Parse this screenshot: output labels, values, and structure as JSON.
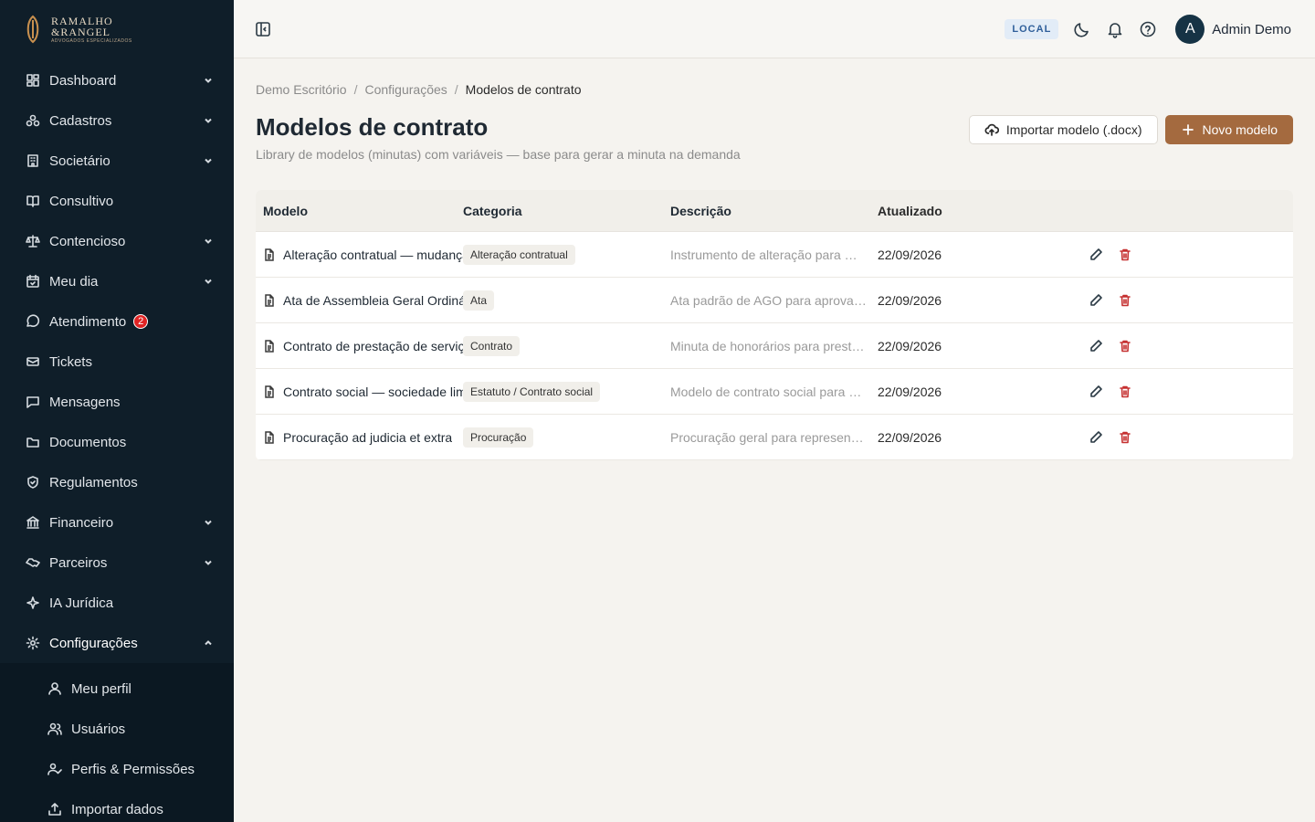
{
  "brand": {
    "line1": "RAMALHO",
    "line2": "&RANGEL",
    "tagline": "ADVOGADOS ESPECIALIZADOS",
    "accent": "#a46a3f",
    "sidebar_bg": "#0f1e29"
  },
  "sidebar": {
    "items": [
      {
        "label": "Dashboard",
        "icon": "dashboard-icon",
        "expandable": true
      },
      {
        "label": "Cadastros",
        "icon": "cadastros-icon",
        "expandable": true
      },
      {
        "label": "Societário",
        "icon": "building-icon",
        "expandable": true
      },
      {
        "label": "Consultivo",
        "icon": "book-icon",
        "expandable": false
      },
      {
        "label": "Contencioso",
        "icon": "scale-icon",
        "expandable": true
      },
      {
        "label": "Meu dia",
        "icon": "calendar-icon",
        "expandable": true
      },
      {
        "label": "Atendimento",
        "icon": "chat-icon",
        "expandable": false,
        "badge": "2"
      },
      {
        "label": "Tickets",
        "icon": "ticket-icon",
        "expandable": false
      },
      {
        "label": "Mensagens",
        "icon": "message-icon",
        "expandable": false
      },
      {
        "label": "Documentos",
        "icon": "folder-icon",
        "expandable": false
      },
      {
        "label": "Regulamentos",
        "icon": "shield-icon",
        "expandable": false
      },
      {
        "label": "Financeiro",
        "icon": "bank-icon",
        "expandable": true
      },
      {
        "label": "Parceiros",
        "icon": "handshake-icon",
        "expandable": true
      },
      {
        "label": "IA Jurídica",
        "icon": "sparkle-icon",
        "expandable": false
      },
      {
        "label": "Configurações",
        "icon": "gear-icon",
        "expandable": true,
        "expanded": true
      }
    ],
    "subitems": [
      {
        "label": "Meu perfil",
        "icon": "user-icon"
      },
      {
        "label": "Usuários",
        "icon": "users-icon"
      },
      {
        "label": "Perfis & Permissões",
        "icon": "user-check-icon"
      },
      {
        "label": "Importar dados",
        "icon": "upload-icon"
      }
    ]
  },
  "topbar": {
    "env": "LOCAL",
    "avatar_initial": "A",
    "user_name": "Admin Demo"
  },
  "breadcrumb": [
    "Demo Escritório",
    "Configurações",
    "Modelos de contrato"
  ],
  "page": {
    "title": "Modelos de contrato",
    "subtitle": "Library de modelos (minutas) com variáveis — base para gerar a minuta na demanda",
    "import_label": "Importar modelo (.docx)",
    "new_label": "Novo modelo"
  },
  "table": {
    "headers": [
      "Modelo",
      "Categoria",
      "Descrição",
      "Atualizado"
    ],
    "rows": [
      {
        "model": "Alteração contratual — mudança de endereço",
        "category": "Alteração contratual",
        "description": "Instrumento de alteração para mudança de endereço da sede",
        "updated": "22/09/2026"
      },
      {
        "model": "Ata de Assembleia Geral Ordinária",
        "category": "Ata",
        "description": "Ata padrão de AGO para aprovação de contas",
        "updated": "22/09/2026"
      },
      {
        "model": "Contrato de prestação de serviços advocatícios",
        "category": "Contrato",
        "description": "Minuta de honorários para prestação de serviços",
        "updated": "22/09/2026"
      },
      {
        "model": "Contrato social — sociedade limitada",
        "category": "Estatuto / Contrato social",
        "description": "Modelo de contrato social para sociedade limitada",
        "updated": "22/09/2026"
      },
      {
        "model": "Procuração ad judicia et extra",
        "category": "Procuração",
        "description": "Procuração geral para representação judicial",
        "updated": "22/09/2026"
      }
    ]
  }
}
